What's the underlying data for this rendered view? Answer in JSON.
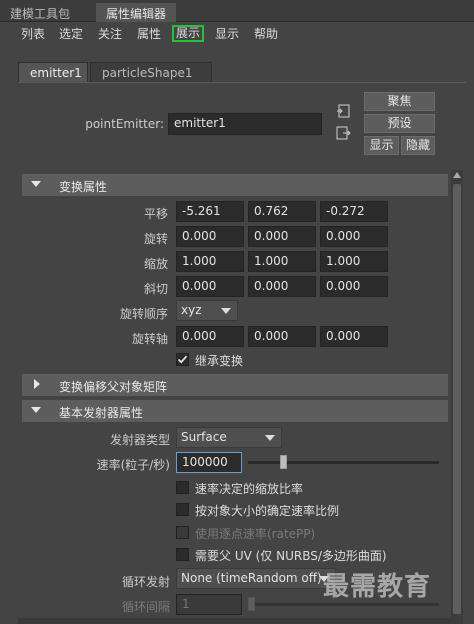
{
  "top_tabs": [
    "建模工具包",
    "属性编辑器"
  ],
  "menu": [
    "列表",
    "选定",
    "关注",
    "属性",
    "展示",
    "显示",
    "帮助"
  ],
  "node_tabs": [
    "emitter1",
    "particleShape1"
  ],
  "node": {
    "label": "pointEmitter:",
    "value": "emitter1"
  },
  "side_buttons": {
    "focus": "聚焦",
    "preset": "预设",
    "show": "显示",
    "hide": "隐藏"
  },
  "sections": {
    "transform": "变换属性",
    "offset_parent": "变换偏移父对象矩阵",
    "basic_emitter": "基本发射器属性"
  },
  "transform_attrs": [
    {
      "label": "平移",
      "values": [
        "-5.261",
        "0.762",
        "-0.272"
      ]
    },
    {
      "label": "旋转",
      "values": [
        "0.000",
        "0.000",
        "0.000"
      ]
    },
    {
      "label": "缩放",
      "values": [
        "1.000",
        "1.000",
        "1.000"
      ]
    },
    {
      "label": "斜切",
      "values": [
        "0.000",
        "0.000",
        "0.000"
      ]
    }
  ],
  "rotate_order": {
    "label": "旋转顺序",
    "value": "xyz"
  },
  "rotate_axis": {
    "label": "旋转轴",
    "values": [
      "0.000",
      "0.000",
      "0.000"
    ]
  },
  "inherit_transform": {
    "label": "继承变换",
    "checked": true
  },
  "emitter_type": {
    "label": "发射器类型",
    "value": "Surface"
  },
  "rate": {
    "label": "速率(粒子/秒)",
    "value": "100000",
    "slider_fraction": 0.17
  },
  "checkboxes": [
    {
      "label": "速率决定的缩放比率",
      "checked": false,
      "enabled": true
    },
    {
      "label": "按对象大小的确定速率比例",
      "checked": false,
      "enabled": true
    },
    {
      "label": "使用逐点速率(ratePP)",
      "checked": false,
      "enabled": false
    },
    {
      "label": "需要父 UV (仅 NURBS/多边形曲面)",
      "checked": false,
      "enabled": true
    }
  ],
  "cycle_emission": {
    "label": "循环发射",
    "value": "None (timeRandom off)"
  },
  "cycle_interval": {
    "label": "循环间隔",
    "value": "1",
    "slider_fraction": 0.0
  },
  "watermark": "最需教育"
}
